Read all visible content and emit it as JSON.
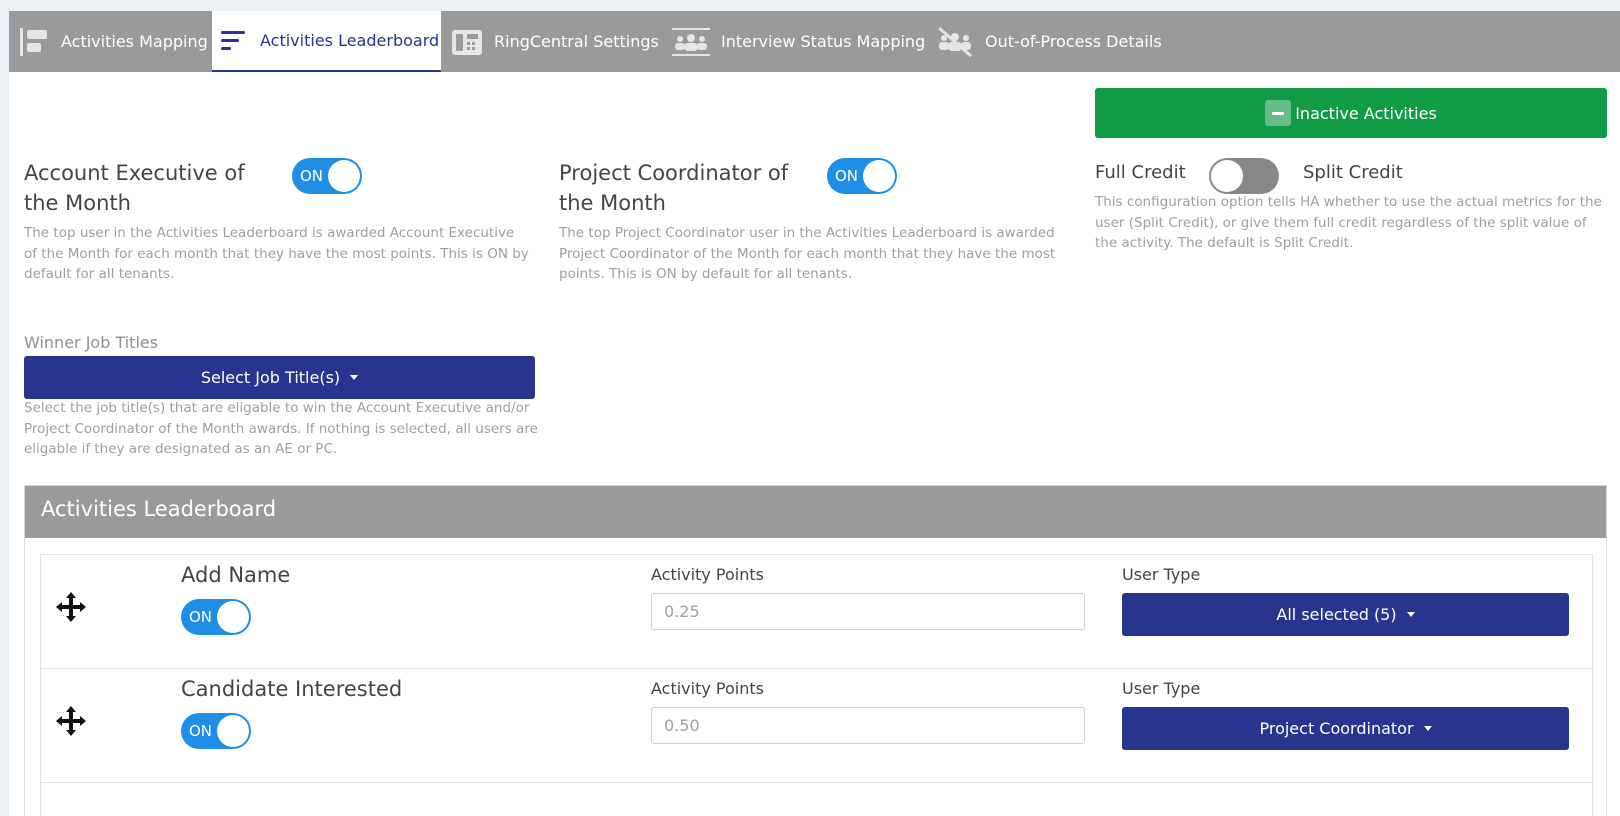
{
  "tabs": [
    {
      "label": "Activities Mapping",
      "icon": "activities-mapping-icon"
    },
    {
      "label": "Activities Leaderboard",
      "icon": "leaderboard-icon",
      "active": true
    },
    {
      "label": "RingCentral Settings",
      "icon": "phone-icon"
    },
    {
      "label": "Interview Status Mapping",
      "icon": "group-icon"
    },
    {
      "label": "Out-of-Process Details",
      "icon": "group-off-icon"
    }
  ],
  "inactive_button": {
    "label": "Inactive Activities"
  },
  "ae": {
    "title": "Account Executive of the Month",
    "toggle": "ON",
    "description": "The top user in the Activities Leaderboard is awarded Account Executive of the Month for each month that they have the most points. This is ON by default for all tenants."
  },
  "pc": {
    "title": "Project Coordinator of the Month",
    "toggle": "ON",
    "description": "The top Project Coordinator user in the Activities Leaderboard is awarded Project Coordinator of the Month for each month that they have the most points. This is ON by default for all tenants."
  },
  "credit": {
    "left_label": "Full Credit",
    "right_label": "Split Credit",
    "description": "This configuration option tells HA whether to use the actual metrics for the user (Split Credit), or give them full credit regardless of the split value of the activity. The default is Split Credit."
  },
  "winner": {
    "label": "Winner Job Titles",
    "button": "Select Job Title(s)",
    "description": "Select the job title(s) that are eligable to win the Account Executive and/or Project Coordinator of the Month awards. If nothing is selected, all users are eligable if they are designated as an AE or PC."
  },
  "leaderboard": {
    "title": "Activities Leaderboard",
    "rows": [
      {
        "name": "Add Name",
        "toggle": "ON",
        "points_label": "Activity Points",
        "points_value": "0.25",
        "user_type_label": "User Type",
        "user_type_value": "All selected (5)"
      },
      {
        "name": "Candidate Interested",
        "toggle": "ON",
        "points_label": "Activity Points",
        "points_value": "0.50",
        "user_type_label": "User Type",
        "user_type_value": "Project Coordinator"
      }
    ]
  },
  "colors": {
    "primary": "#27358f",
    "success": "#129b45",
    "toggle_on": "#1f8ee6",
    "header_gray": "#9a9a9a"
  }
}
